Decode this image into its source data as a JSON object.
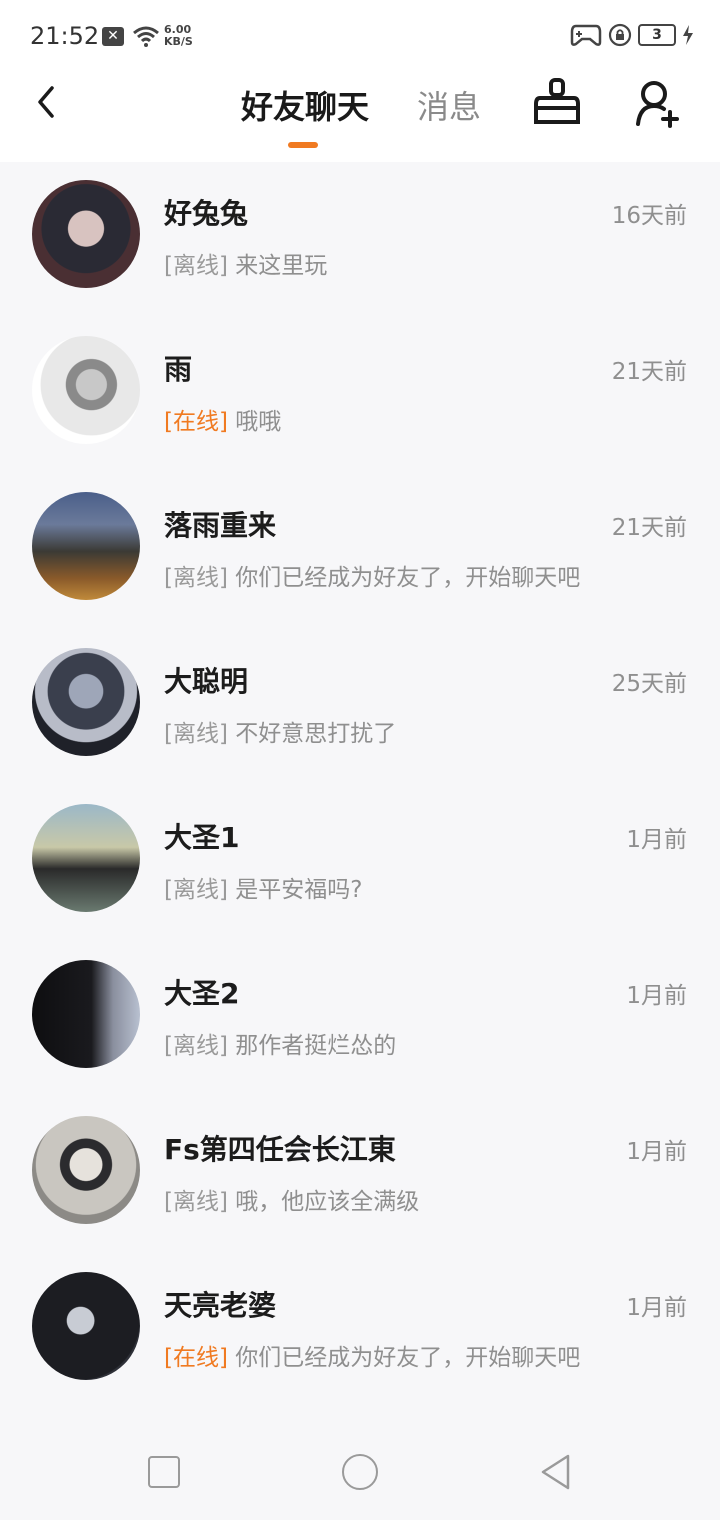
{
  "status_bar": {
    "time": "21:52",
    "net_speed_value": "6.00",
    "net_speed_unit": "KB/S",
    "battery_level": "3"
  },
  "header": {
    "tabs": [
      {
        "label": "好友聊天",
        "active": true
      },
      {
        "label": "消息",
        "active": false
      }
    ],
    "accent_color": "#f07a21"
  },
  "chats": [
    {
      "name": "好兔兔",
      "time": "16天前",
      "status": "[离线]",
      "online": false,
      "message": "来这里玩"
    },
    {
      "name": "雨",
      "time": "21天前",
      "status": "[在线]",
      "online": true,
      "message": "哦哦"
    },
    {
      "name": "落雨重来",
      "time": "21天前",
      "status": "[离线]",
      "online": false,
      "message": "你们已经成为好友了，开始聊天吧"
    },
    {
      "name": "大聪明",
      "time": "25天前",
      "status": "[离线]",
      "online": false,
      "message": "不好意思打扰了"
    },
    {
      "name": "大圣1",
      "time": "1月前",
      "status": "[离线]",
      "online": false,
      "message": "是平安福吗?"
    },
    {
      "name": "大圣2",
      "time": "1月前",
      "status": "[离线]",
      "online": false,
      "message": "那作者挺烂怂的"
    },
    {
      "name": "Fs第四任会长江東",
      "time": "1月前",
      "status": "[离线]",
      "online": false,
      "message": "哦，他应该全满级"
    },
    {
      "name": "天亮老婆",
      "time": "1月前",
      "status": "[在线]",
      "online": true,
      "message": "你们已经成为好友了，开始聊天吧"
    }
  ]
}
